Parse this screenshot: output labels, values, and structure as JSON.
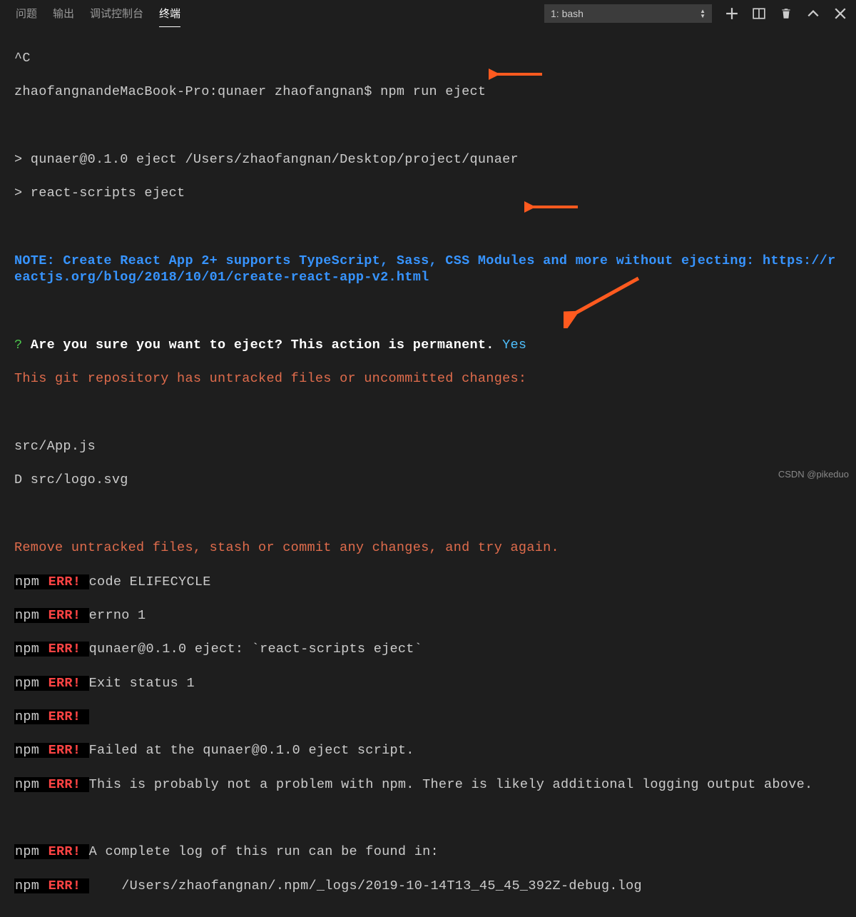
{
  "panel_tabs": {
    "problems": "问题",
    "output": "输出",
    "debug_console": "调试控制台",
    "terminal": "终端"
  },
  "terminal_selector": "1: bash",
  "output": {
    "l1": "^C",
    "l2": "zhaofangnandeMacBook-Pro:qunaer zhaofangnan$ npm run eject",
    "l3": "",
    "l4": "> qunaer@0.1.0 eject /Users/zhaofangnan/Desktop/project/qunaer",
    "l5": "> react-scripts eject",
    "l6": "",
    "note": "NOTE: Create React App 2+ supports TypeScript, Sass, CSS Modules and more without ejecting: https://reactjs.org/blog/2018/10/01/create-react-app-v2.html",
    "l8": "",
    "question_prefix": "?",
    "question_text": " Are you sure you want to eject? This action is permanent. ",
    "question_answer": "Yes",
    "git_warn": "This git repository has untracked files or uncommitted changes:",
    "l11": "",
    "l12": "src/App.js",
    "l13": "D src/logo.svg",
    "l14": "",
    "remove_msg": "Remove untracked files, stash or commit any changes, and try again.",
    "npm_label": "npm",
    "err_label": " ERR! ",
    "err1": "code ELIFECYCLE",
    "err2": "errno 1",
    "err3": "qunaer@0.1.0 eject: `react-scripts eject`",
    "err4": "Exit status 1",
    "err5": "",
    "err6": "Failed at the qunaer@0.1.0 eject script.",
    "err7": "This is probably not a problem with npm. There is likely additional logging output above.",
    "l22": "",
    "err8": "A complete log of this run can be found in:",
    "err9": "    /Users/zhaofangnan/.npm/_logs/2019-10-14T13_45_45_392Z-debug.log"
  },
  "watermark": "CSDN @pikeduo"
}
